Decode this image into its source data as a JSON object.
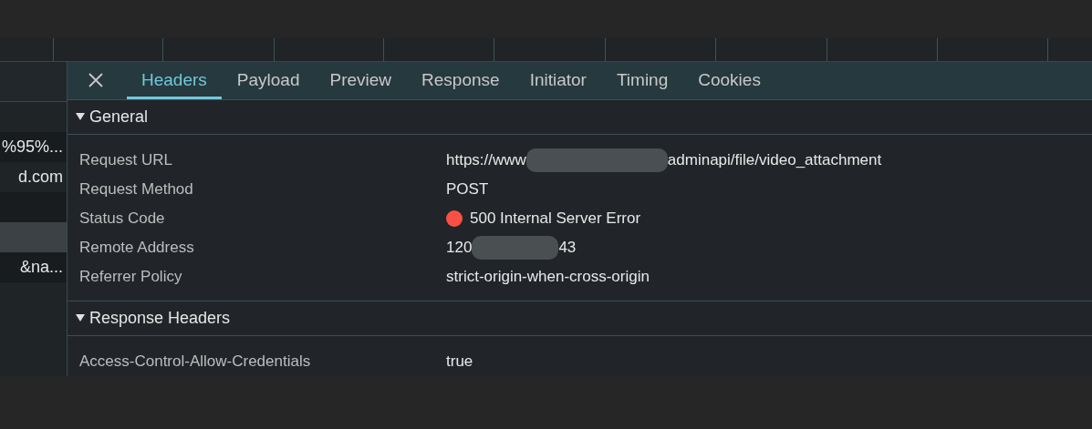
{
  "request_list": [
    {
      "selected": false
    },
    {
      "text": "%95%...",
      "selected": false
    },
    {
      "text": "d.com",
      "selected": false
    },
    {
      "selected": false
    },
    {
      "selected": true
    },
    {
      "text": "&na...",
      "selected": false
    },
    {
      "selected": false
    }
  ],
  "tabs": [
    {
      "label": "Headers",
      "selected": true
    },
    {
      "label": "Payload",
      "selected": false
    },
    {
      "label": "Preview",
      "selected": false
    },
    {
      "label": "Response",
      "selected": false
    },
    {
      "label": "Initiator",
      "selected": false
    },
    {
      "label": "Timing",
      "selected": false
    },
    {
      "label": "Cookies",
      "selected": false
    }
  ],
  "sections": [
    {
      "title": "General",
      "expanded": true,
      "rows": [
        {
          "name": "Request URL",
          "kind": "redacted",
          "value_parts": [
            "https://www",
            "adminapi/file/video_attachment"
          ]
        },
        {
          "name": "Request Method",
          "kind": "text",
          "value": "POST"
        },
        {
          "name": "Status Code",
          "kind": "status",
          "value": "500 Internal Server Error",
          "color": "#fa5044"
        },
        {
          "name": "Remote Address",
          "kind": "redacted",
          "value_parts": [
            "120",
            "43"
          ]
        },
        {
          "name": "Referrer Policy",
          "kind": "text",
          "value": "strict-origin-when-cross-origin"
        }
      ]
    },
    {
      "title": "Response Headers",
      "expanded": true,
      "rows": [
        {
          "name": "Access-Control-Allow-Credentials",
          "kind": "text",
          "value": "true"
        }
      ]
    }
  ]
}
